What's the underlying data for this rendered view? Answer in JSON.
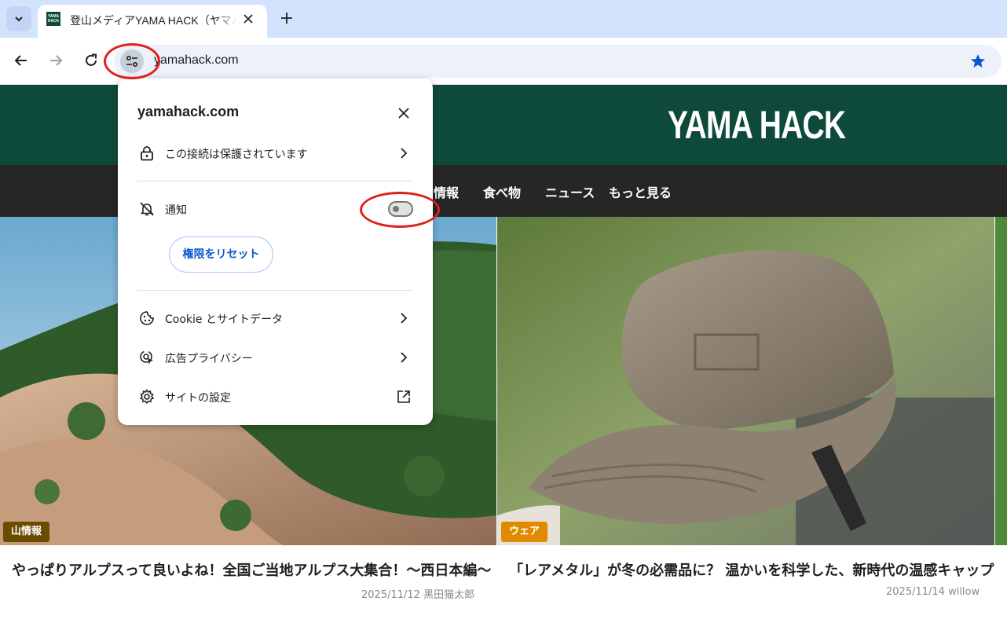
{
  "browser": {
    "tab": {
      "title": "登山メディアYAMA HACK（ヤマハック）",
      "favicon_text": "YAMA HACK"
    },
    "url": "yamahack.com"
  },
  "site": {
    "logo": "YAMA HACK",
    "nav": [
      "情報",
      "食べ物",
      "ニュース",
      "もっと見る"
    ],
    "articles": [
      {
        "tag": "山情報",
        "tag_color": "#6b4b00",
        "title": "やっぱりアルプスって良いよね！全国ご当地アルプス大集合！～西日本編～",
        "date": "2025/11/12",
        "author": "黒田猫太郎"
      },
      {
        "tag": "ウェア",
        "tag_color": "#e08a00",
        "title": "「レアメタル」が冬の必需品に？ 温かいを科学した、新時代の温感キャップ",
        "date": "2025/11/14",
        "author": "willow"
      }
    ]
  },
  "popup": {
    "domain": "yamahack.com",
    "connection": "この接続は保護されています",
    "notifications": {
      "label": "通知",
      "enabled": false
    },
    "reset_button": "権限をリセット",
    "cookie": "Cookie とサイトデータ",
    "ad_privacy": "広告プライバシー",
    "site_settings": "サイトの設定"
  },
  "colors": {
    "header_green": "#0e4a3a",
    "nav_dark": "#262626",
    "annotation_red": "#e0201a"
  }
}
